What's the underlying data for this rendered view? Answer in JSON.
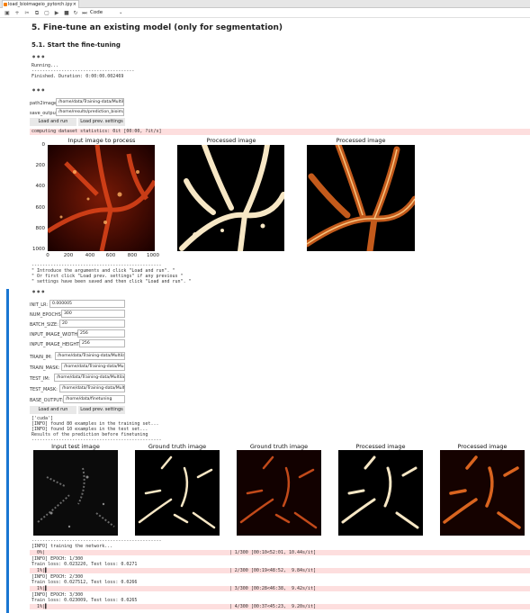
{
  "tab": {
    "title": "load_bioimageio_pytorch.ipy"
  },
  "toolbar": {
    "cell_type": "Code"
  },
  "section": {
    "h2": "5. Fine-tune an existing model (only for segmentation)",
    "h3": "5.1. Start the fine-tuning"
  },
  "cell1": {
    "dots": "•••",
    "out": "Running...\n--------------------------------------\nFinished. Duration: 0:00:00.002469"
  },
  "cell2": {
    "dots": "•••",
    "fields": [
      {
        "label": "path2image:",
        "value": "/home/data/Training-data/Multilabel"
      },
      {
        "label": "save_outputs:",
        "value": "/home/results/prediction_bioimageio"
      }
    ],
    "btn_load": "Load and run",
    "btn_prev": "Load prev. settings",
    "stderr": "computing dataset statistics: 0it [00:00, ?it/s]"
  },
  "plots1": {
    "titles": [
      "Input image to process",
      "Processed image",
      "Processed image"
    ],
    "yticks": [
      "0",
      "200",
      "400",
      "600",
      "800",
      "1000"
    ],
    "xticks": [
      "0",
      "200",
      "400",
      "600",
      "800",
      "1000"
    ]
  },
  "cell2_out": "------------------------------------------------\n\" Introduce the arguments and click \"Load and run\". \"\n\" Or first click \"Load prev. settings\" if any previous \"\n\" settings have been saved and then click \"Load and run\". \"",
  "cell3": {
    "dots": "•••",
    "fields": [
      {
        "label": "INIT_LR:",
        "value": "0.000005"
      },
      {
        "label": "NUM_EPOCHS:",
        "value": "300"
      },
      {
        "label": "BATCH_SIZE:",
        "value": "20"
      },
      {
        "label": "INPUT_IMAGE_WIDTH:",
        "value": "256"
      },
      {
        "label": "INPUT_IMAGE_HEIGHT:",
        "value": "256"
      },
      {
        "label": "TRAIN_IM:",
        "value": "/home/data/Training-data/Multilabel_"
      },
      {
        "label": "TRAIN_MASK:",
        "value": "/home/data/Training-data/Multila"
      },
      {
        "label": "TEST_IM:",
        "value": "/home/data/Training-data/Multilabel_s"
      },
      {
        "label": "TEST_MASK:",
        "value": "/home/data/Training-data/Multilab"
      },
      {
        "label": "BASE_OUTPUT:",
        "value": "/home/data/finetuning"
      }
    ],
    "btn_load": "Load and run",
    "btn_prev": "Load prev. settings",
    "out": "['cuda']\n[INFO] found 80 examples in the training set...\n[INFO] found 10 examples in the test set...\nResults of the prediction before finetuning\n------------------------------------------------"
  },
  "plots2": {
    "titles": [
      "Input test image",
      "Ground truth image",
      "Ground truth image",
      "Processed image",
      "Processed image"
    ]
  },
  "training": {
    "header": "------------------------------------------------\n[INFO] training the network...",
    "rows": [
      {
        "type": "err",
        "text": "  0%|                                                                    | 1/300 [00:10<52:01, 10.44s/it]"
      },
      {
        "type": "out",
        "text": "[INFO] EPOCH: 1/300\nTrain loss: 0.023220, Test loss: 0.0271"
      },
      {
        "type": "err",
        "text": "  1%|▌                                                                   | 2/300 [00:19<48:52,  9.84s/it]"
      },
      {
        "type": "out",
        "text": "[INFO] EPOCH: 2/300\nTrain loss: 0.027512, Test loss: 0.0266"
      },
      {
        "type": "err",
        "text": "  1%|▌                                                                   | 3/300 [00:28<46:38,  9.42s/it]"
      },
      {
        "type": "out",
        "text": "[INFO] EPOCH: 3/300\nTrain loss: 0.023009, Test loss: 0.0265"
      },
      {
        "type": "err",
        "text": "  1%|▌                                                                   | 4/300 [00:37<45:23,  9.20s/it]"
      }
    ]
  }
}
